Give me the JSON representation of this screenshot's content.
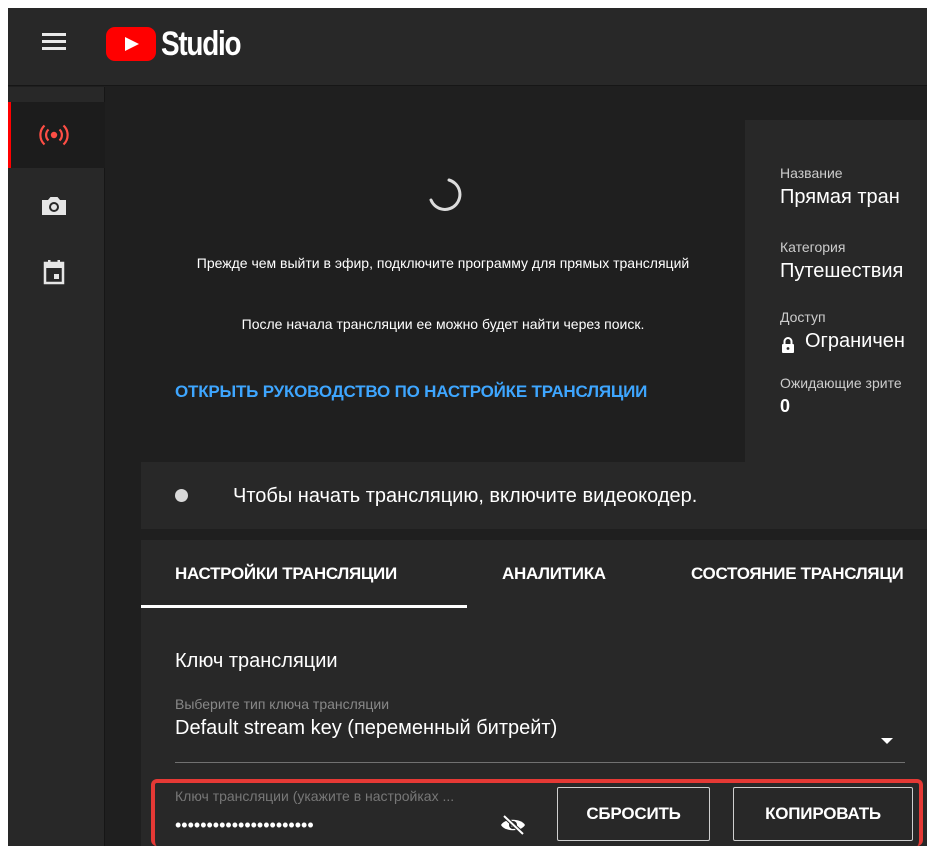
{
  "app": {
    "logo_text": "Studio",
    "icons": {
      "menu": "hamburger-menu-icon",
      "logo": "youtube-play-logo",
      "live": "live-broadcast-icon",
      "camera": "camera-icon",
      "calendar": "calendar-icon",
      "lock": "lock-icon",
      "eye": "eye-slash-icon",
      "spinner": "loading-spinner-icon"
    },
    "colors": {
      "accent_red": "#ff0000",
      "link_blue": "#3ea6ff",
      "highlight_red": "#e53935"
    }
  },
  "preview": {
    "message_1": "Прежде чем выйти в эфир, подключите программу для прямых трансляций",
    "message_2": "После начала трансляции ее можно будет найти через поиск.",
    "guide_link": "ОТКРЫТЬ РУКОВОДСТВО ПО НАСТРОЙКЕ ТРАНСЛЯЦИИ"
  },
  "info": {
    "title_label": "Название",
    "title_value": "Прямая тран",
    "category_label": "Категория",
    "category_value": "Путешествия",
    "access_label": "Доступ",
    "access_value": "Ограничен",
    "viewers_label": "Ожидающие зрите",
    "viewers_value": "0"
  },
  "status": {
    "text": "Чтобы начать трансляцию, включите видеокодер."
  },
  "tabs": [
    {
      "label": "НАСТРОЙКИ ТРАНСЛЯЦИИ",
      "active": true
    },
    {
      "label": "АНАЛИТИКА",
      "active": false
    },
    {
      "label": "СОСТОЯНИЕ ТРАНСЛЯЦИ",
      "active": false
    }
  ],
  "settings": {
    "section_title": "Ключ трансляции",
    "key_type_label": "Выберите тип ключа трансляции",
    "key_type_value": "Default stream key (переменный битрейт)",
    "key_label": "Ключ трансляции (укажите в настройках ...",
    "key_value": "••••••••••••••••••••••",
    "reset_button": "СБРОСИТЬ",
    "copy_button": "КОПИРОВАТЬ"
  }
}
